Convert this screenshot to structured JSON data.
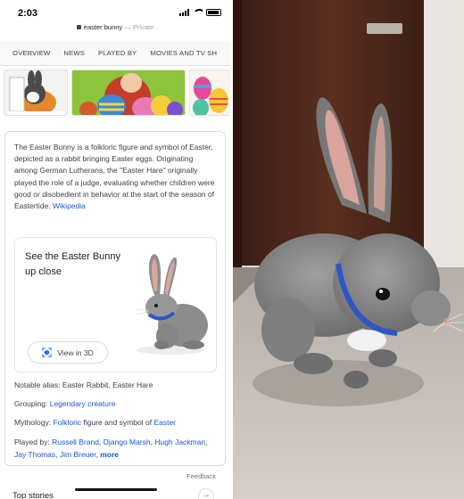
{
  "status_bar": {
    "time": "2:03"
  },
  "browser": {
    "url": "easter bunny",
    "url_suffix": " — Private"
  },
  "tabs": [
    "OVERVIEW",
    "NEWS",
    "PLAYED BY",
    "MOVIES AND TV SH"
  ],
  "knowledge_panel": {
    "description": "The Easter Bunny is a folkloric figure and symbol of Easter, depicted as a rabbit bringing Easter eggs. Originating among German Lutherans, the \"Easter Hare\" originally played the role of a judge, evaluating whether children were good or disobedient in behavior at the start of the season of Eastertide.",
    "source_link": "Wikipedia",
    "view3d_card": {
      "title": "See the Easter Bunny up close",
      "button_label": "View in 3D"
    },
    "facts": {
      "alias_label": "Notable alias:",
      "alias_value": "Easter Rabbit, Easter Hare",
      "grouping_label": "Grouping:",
      "grouping_link": "Legendary creature",
      "mythology_label": "Mythology:",
      "mythology_link1": "Folkloric",
      "mythology_text": "figure and symbol of",
      "mythology_link2": "Easter",
      "played_label": "Played by:",
      "played_links": [
        "Russell Brand",
        "Django Marsh",
        "Hugh Jackman",
        "Jay Thomas",
        "Jim Breuer"
      ],
      "played_more": "more"
    },
    "feedback": "Feedback"
  },
  "next_section": {
    "title": "Top stories"
  },
  "colors": {
    "link": "#1558d6",
    "collar": "#2d56c7"
  }
}
